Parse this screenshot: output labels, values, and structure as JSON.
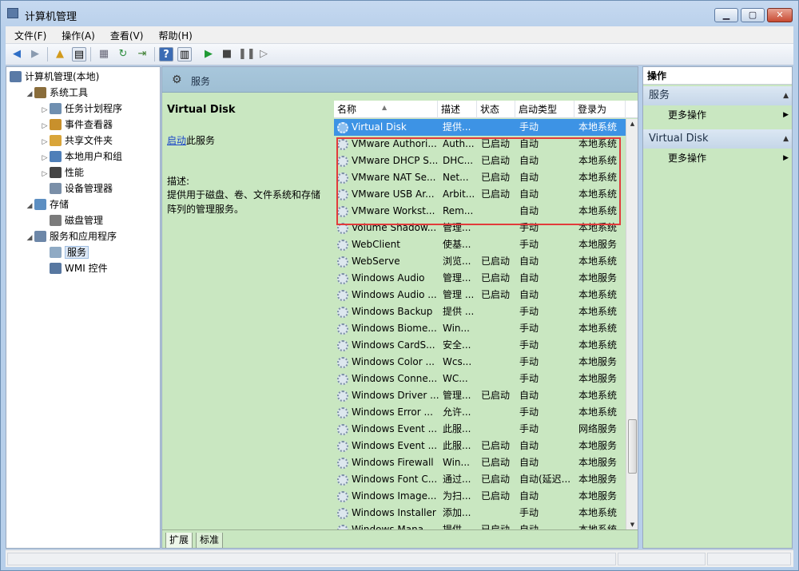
{
  "window": {
    "title": "计算机管理",
    "min_icon": "minimize-icon",
    "max_icon": "maximize-icon",
    "close_icon": "close-icon"
  },
  "menu": [
    "文件(F)",
    "操作(A)",
    "查看(V)",
    "帮助(H)"
  ],
  "tree": [
    {
      "label": "计算机管理(本地)",
      "icon": "computer-management-icon",
      "expander": "",
      "level": 0
    },
    {
      "label": "系统工具",
      "icon": "system-tools-icon",
      "expander": "◢",
      "level": 1
    },
    {
      "label": "任务计划程序",
      "icon": "task-scheduler-icon",
      "expander": "▷",
      "level": 2
    },
    {
      "label": "事件查看器",
      "icon": "event-viewer-icon",
      "expander": "▷",
      "level": 2
    },
    {
      "label": "共享文件夹",
      "icon": "shared-folders-icon",
      "expander": "▷",
      "level": 2
    },
    {
      "label": "本地用户和组",
      "icon": "local-users-icon",
      "expander": "▷",
      "level": 2
    },
    {
      "label": "性能",
      "icon": "performance-icon",
      "expander": "▷",
      "level": 2
    },
    {
      "label": "设备管理器",
      "icon": "device-manager-icon",
      "expander": "",
      "level": 2
    },
    {
      "label": "存储",
      "icon": "storage-icon",
      "expander": "◢",
      "level": 1
    },
    {
      "label": "磁盘管理",
      "icon": "disk-management-icon",
      "expander": "",
      "level": 2
    },
    {
      "label": "服务和应用程序",
      "icon": "services-apps-icon",
      "expander": "◢",
      "level": 1
    },
    {
      "label": "服务",
      "icon": "services-icon",
      "expander": "",
      "level": 2,
      "selected": true
    },
    {
      "label": "WMI 控件",
      "icon": "wmi-control-icon",
      "expander": "",
      "level": 2
    }
  ],
  "middle": {
    "header": "服务",
    "detail": {
      "name": "Virtual Disk",
      "start_link": "启动",
      "start_suffix": "此服务",
      "desc_label": "描述:",
      "desc_text": "提供用于磁盘、卷、文件系统和存储阵列的管理服务。"
    },
    "columns": [
      "名称",
      "描述",
      "状态",
      "启动类型",
      "登录为"
    ],
    "rows": [
      [
        "Virtual Disk",
        "提供...",
        "",
        "手动",
        "本地系统"
      ],
      [
        "VMware Authori...",
        "Auth...",
        "已启动",
        "自动",
        "本地系统"
      ],
      [
        "VMware DHCP S...",
        "DHC...",
        "已启动",
        "自动",
        "本地系统"
      ],
      [
        "VMware NAT Se...",
        "Net...",
        "已启动",
        "自动",
        "本地系统"
      ],
      [
        "VMware USB Ar...",
        "Arbit...",
        "已启动",
        "自动",
        "本地系统"
      ],
      [
        "VMware Workst...",
        "Rem...",
        "",
        "自动",
        "本地系统"
      ],
      [
        "Volume Shadow...",
        "管理...",
        "",
        "手动",
        "本地系统"
      ],
      [
        "WebClient",
        "使基...",
        "",
        "手动",
        "本地服务"
      ],
      [
        "WebServe",
        "浏览...",
        "已启动",
        "自动",
        "本地系统"
      ],
      [
        "Windows Audio",
        "管理...",
        "已启动",
        "自动",
        "本地服务"
      ],
      [
        "Windows Audio ...",
        "管理 ...",
        "已启动",
        "自动",
        "本地系统"
      ],
      [
        "Windows Backup",
        "提供 ...",
        "",
        "手动",
        "本地系统"
      ],
      [
        "Windows Biome...",
        "Win...",
        "",
        "手动",
        "本地系统"
      ],
      [
        "Windows CardS...",
        "安全...",
        "",
        "手动",
        "本地系统"
      ],
      [
        "Windows Color ...",
        "Wcs...",
        "",
        "手动",
        "本地服务"
      ],
      [
        "Windows Conne...",
        "WC...",
        "",
        "手动",
        "本地服务"
      ],
      [
        "Windows Driver ...",
        "管理...",
        "已启动",
        "自动",
        "本地系统"
      ],
      [
        "Windows Error ...",
        "允许...",
        "",
        "手动",
        "本地系统"
      ],
      [
        "Windows Event ...",
        "此服...",
        "",
        "手动",
        "网络服务"
      ],
      [
        "Windows Event ...",
        "此服...",
        "已启动",
        "自动",
        "本地服务"
      ],
      [
        "Windows Firewall",
        "Win...",
        "已启动",
        "自动",
        "本地服务"
      ],
      [
        "Windows Font C...",
        "通过...",
        "已启动",
        "自动(延迟...",
        "本地服务"
      ],
      [
        "Windows Image...",
        "为扫...",
        "已启动",
        "自动",
        "本地服务"
      ],
      [
        "Windows Installer",
        "添加...",
        "",
        "手动",
        "本地系统"
      ],
      [
        "Windows Mana...",
        "提供...",
        "已启动",
        "自动",
        "本地系统"
      ]
    ],
    "tabs": [
      "扩展",
      "标准"
    ]
  },
  "actions": {
    "header": "操作",
    "sections": [
      {
        "title": "服务",
        "item": "更多操作"
      },
      {
        "title": "Virtual Disk",
        "item": "更多操作"
      }
    ]
  },
  "colors": {
    "selection": "#3d93e5",
    "highlight_box": "#e23b3b",
    "panel_green": "#c9e7c1"
  }
}
